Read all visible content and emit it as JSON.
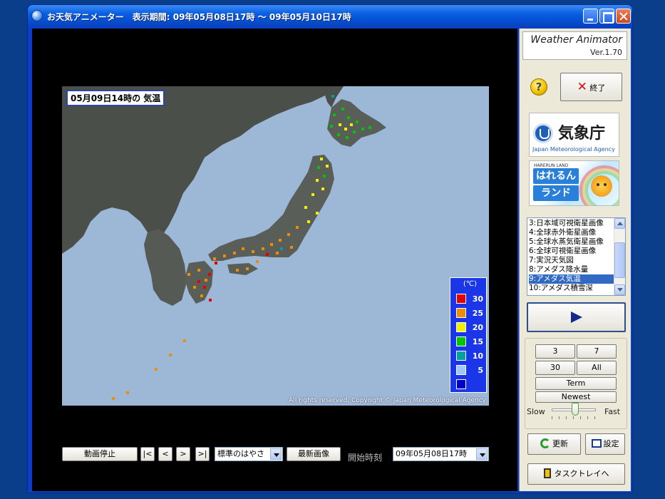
{
  "window": {
    "title": "お天気アニメーター　表示期間: 09年05月08日17時 ～ 09年05月10日17時"
  },
  "map": {
    "title": "05月09日14時の 気温",
    "copyright": "All rights reserved. Copyright © Japan Meteorological Agency",
    "legend": {
      "unit": "(℃)",
      "items": [
        {
          "label": "30",
          "color": "#e60000"
        },
        {
          "label": "25",
          "color": "#f08c00"
        },
        {
          "label": "20",
          "color": "#f0f000"
        },
        {
          "label": "15",
          "color": "#00c800"
        },
        {
          "label": "10",
          "color": "#00a0a0"
        },
        {
          "label": "5",
          "color": "#a0c8ff"
        },
        {
          "label": "",
          "color": "#0000c8"
        }
      ]
    }
  },
  "toolbar": {
    "stop_label": "動画停止",
    "first_label": "|<",
    "prev_label": "<",
    "next_label": ">",
    "last_label": ">|",
    "speed_select": "標準のはやさ",
    "latest_label": "最新画像",
    "start_label": "開始時刻",
    "start_select": "09年05月08日17時"
  },
  "panel": {
    "app_name": "Weather Animator",
    "version": "Ver.1.70",
    "help_label": "?",
    "exit_label": "終了",
    "jma_name": "気象庁",
    "jma_en": "Japan Meteorological Agency",
    "hare_top": "HARERUN LAND",
    "hare_line1": "はれるん",
    "hare_line2": "ランド",
    "list_items": [
      "3:日本域可視衛星画像",
      "4:全球赤外衛星画像",
      "5:全球水蒸気衛星画像",
      "6:全球可視衛星画像",
      "7:実況天気図",
      "8:アメダス降水量",
      "9:アメダス気温",
      "10:アメダス積雪深"
    ],
    "selected_index": 6,
    "range_buttons": [
      "3",
      "7",
      "30",
      "All"
    ],
    "term_label": "Term",
    "newest_label": "Newest",
    "slow_label": "Slow",
    "fast_label": "Fast",
    "update_label": "更新",
    "settings_label": "設定",
    "tray_label": "タスクトレイへ"
  },
  "colors": {
    "sea": "#9db8d6",
    "land": "#4a4f4a",
    "selection": "#316ac5"
  }
}
